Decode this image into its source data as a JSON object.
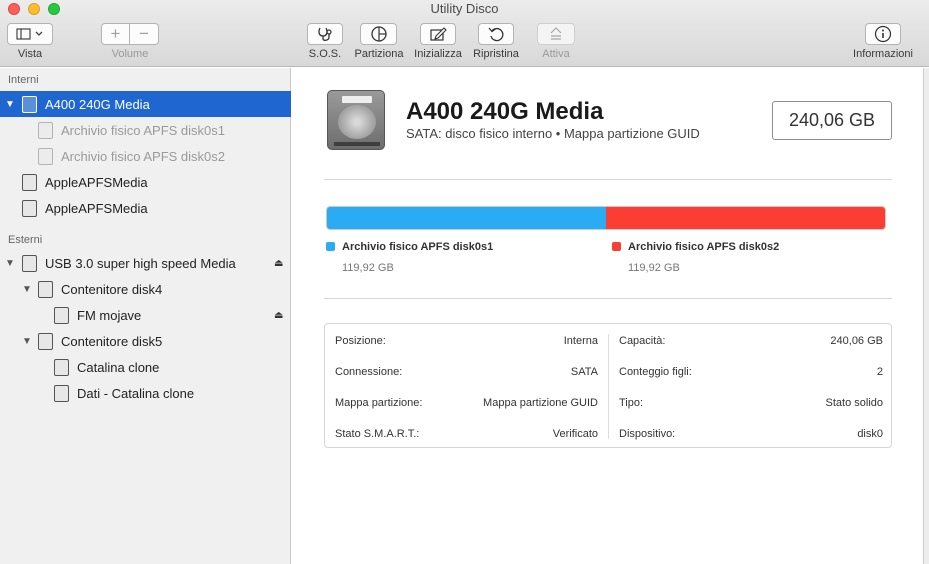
{
  "window": {
    "title": "Utility Disco"
  },
  "toolbar": {
    "vista_label": "Vista",
    "volume_label": "Volume",
    "add_symbol": "+",
    "remove_symbol": "−",
    "sos_label": "S.O.S.",
    "partition_label": "Partiziona",
    "erase_label": "Inizializza",
    "restore_label": "Ripristina",
    "mount_label": "Attiva",
    "info_label": "Informazioni"
  },
  "sidebar": {
    "section_internal": "Interni",
    "section_external": "Esterni",
    "items": [
      {
        "label": "A400 240G Media"
      },
      {
        "label": "Archivio fisico APFS disk0s1"
      },
      {
        "label": "Archivio fisico APFS disk0s2"
      },
      {
        "label": "AppleAPFSMedia"
      },
      {
        "label": "AppleAPFSMedia"
      },
      {
        "label": "USB 3.0 super high speed Media"
      },
      {
        "label": "Contenitore disk4"
      },
      {
        "label": "FM mojave"
      },
      {
        "label": "Contenitore disk5"
      },
      {
        "label": "Catalina clone"
      },
      {
        "label": "Dati - Catalina clone"
      }
    ]
  },
  "disk": {
    "name": "A400 240G Media",
    "subtitle": "SATA: disco fisico interno • Mappa partizione GUID",
    "size": "240,06 GB"
  },
  "partitions": [
    {
      "name": "Archivio fisico APFS disk0s1",
      "size": "119,92 GB",
      "fraction": 0.4995,
      "color": "#29acf4"
    },
    {
      "name": "Archivio fisico APFS disk0s2",
      "size": "119,92 GB",
      "fraction": 0.5005,
      "color": "#fc3d33"
    }
  ],
  "info": {
    "left": [
      {
        "key": "Posizione:",
        "value": "Interna"
      },
      {
        "key": "Connessione:",
        "value": "SATA"
      },
      {
        "key": "Mappa partizione:",
        "value": "Mappa partizione GUID"
      },
      {
        "key": "Stato S.M.A.R.T.:",
        "value": "Verificato"
      }
    ],
    "right": [
      {
        "key": "Capacità:",
        "value": "240,06 GB"
      },
      {
        "key": "Conteggio figli:",
        "value": "2"
      },
      {
        "key": "Tipo:",
        "value": "Stato solido"
      },
      {
        "key": "Dispositivo:",
        "value": "disk0"
      }
    ]
  },
  "colors": {
    "selection": "#1f66d1",
    "partition1": "#29acf4",
    "partition2": "#fc3d33"
  }
}
